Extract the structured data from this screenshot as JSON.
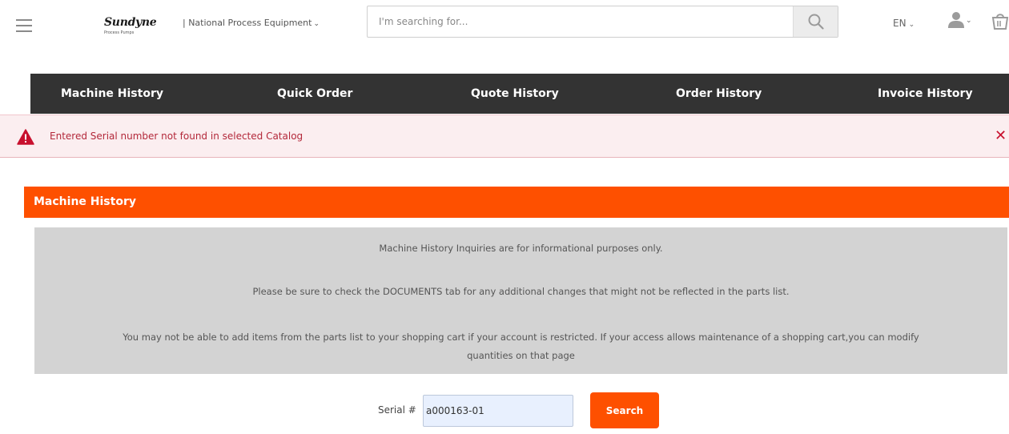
{
  "header": {
    "brand_name": "Sundyne",
    "brand_tagline": "Process Pumps",
    "catalog_label": "| National Process Equipment",
    "chevron": "⌄",
    "search_placeholder": "I'm searching for...",
    "language": "EN",
    "icons": {
      "menu": "hamburger-menu-icon",
      "search": "magnifier-icon",
      "user": "user-icon",
      "cart": "shopping-cart-icon"
    }
  },
  "nav": {
    "items": [
      {
        "label": "Machine History"
      },
      {
        "label": "Quick Order"
      },
      {
        "label": "Quote History"
      },
      {
        "label": "Order History"
      },
      {
        "label": "Invoice History"
      }
    ]
  },
  "alert": {
    "message": "Entered Serial number not found in selected Catalog",
    "close": "✕",
    "icons": {
      "warning": "warning-triangle-icon",
      "close": "close-icon"
    }
  },
  "section": {
    "title": "Machine History",
    "info_lines": [
      "Machine History Inquiries are for informational purposes only.",
      "Please be sure to check the DOCUMENTS tab for any additional changes that might not be reflected in the parts list.",
      "You may not be able to add items from the parts list to your shopping cart if your account is restricted. If your access allows maintenance of a shopping cart,you can modify",
      "quantities on that page"
    ]
  },
  "serial_search": {
    "label": "Serial #",
    "value": "a000163-01",
    "button_label": "Search"
  },
  "colors": {
    "nav_bg": "#333333",
    "accent_orange": "#fe5000",
    "alert_bg": "#fbeef0",
    "alert_text": "#b3283a",
    "alert_icon": "#c8102e",
    "panel_bg": "#d3d3d3",
    "input_bg": "#e8f0fe"
  }
}
